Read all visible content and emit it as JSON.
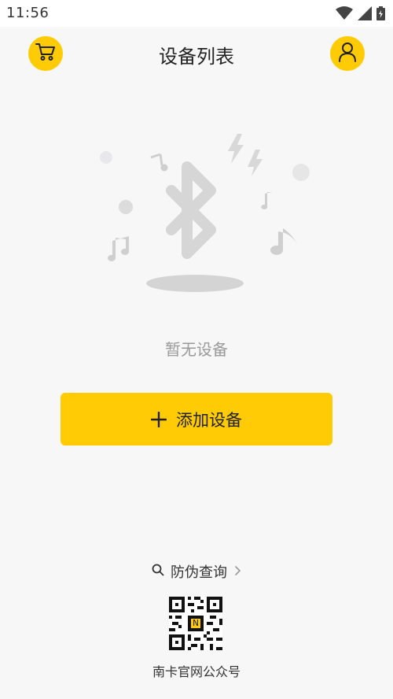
{
  "status_bar": {
    "time": "11:56",
    "icons": [
      "wifi-icon",
      "cellular-icon",
      "battery-icon"
    ]
  },
  "header": {
    "title": "设备列表",
    "left_icon": "shopping-cart-icon",
    "right_icon": "user-icon"
  },
  "empty_state": {
    "message": "暂无设备",
    "illustration_icons": [
      "bluetooth-icon",
      "music-note-icon",
      "lightning-icon"
    ]
  },
  "actions": {
    "add_device_label": "添加设备"
  },
  "footer": {
    "anti_fake_label": "防伪查询",
    "qr_caption": "南卡官网公众号"
  },
  "colors": {
    "accent": "#ffcb05",
    "background": "#f7f7f7",
    "muted_text": "#9a9a9a"
  }
}
